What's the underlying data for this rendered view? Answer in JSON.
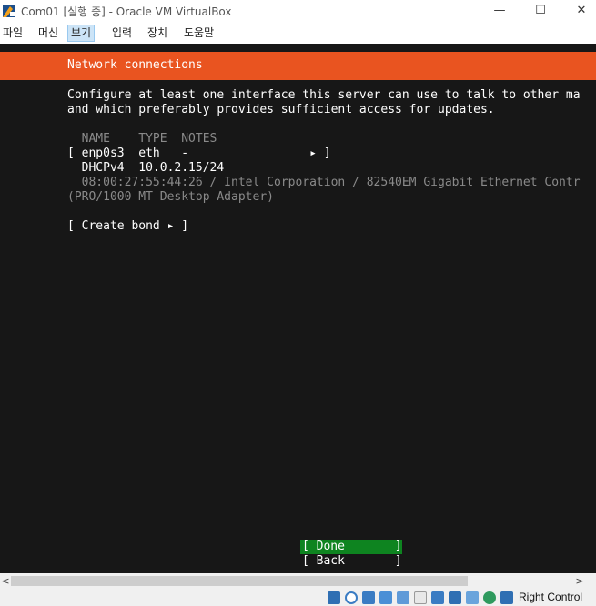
{
  "window": {
    "title": "Com01 [실행 중] - Oracle VM VirtualBox",
    "minimize_glyph": "—",
    "maximize_glyph": "☐",
    "close_glyph": "✕"
  },
  "menu": {
    "items": [
      "파일",
      "머신",
      "보기",
      "입력",
      "장치",
      "도움말"
    ],
    "active": "보기"
  },
  "screen": {
    "header_title": "Network connections",
    "intro_line1": "Configure at least one interface this server can use to talk to other ma",
    "intro_line2": "and which preferably provides sufficient access for updates.",
    "columns_line": "  NAME    TYPE  NOTES",
    "interface_line": "[ enp0s3  eth   -                 ▸ ]",
    "dhcp_line": "  DHCPv4  10.0.2.15/24",
    "hw_line1": "  08:00:27:55:44:26 / Intel Corporation / 82540EM Gigabit Ethernet Contr",
    "hw_line2": "(PRO/1000 MT Desktop Adapter)",
    "create_bond": "[ Create bond ▸ ]",
    "done_button": "[ Done       ]",
    "back_button": "[ Back       ]"
  },
  "scrollbar": {
    "left_arrow": "<",
    "right_arrow": ">"
  },
  "statusbar": {
    "host_key_label": "Right Control",
    "icons": [
      "hard-disk-icon",
      "optical-drive-icon",
      "audio-icon",
      "network-icon",
      "usb-icon",
      "shared-folders-icon",
      "display-icon",
      "recording-icon",
      "mouse-integration-icon",
      "cpu-icon",
      "keyboard-capture-icon"
    ]
  },
  "colors": {
    "header_orange": "#e95420",
    "done_green": "#0e8420",
    "terminal_bg": "#171717",
    "dim_text": "#8a8a8a"
  }
}
